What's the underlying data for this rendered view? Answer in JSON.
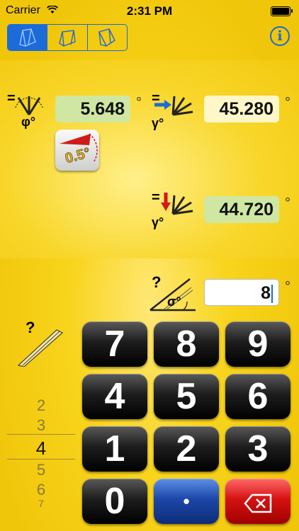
{
  "status_bar": {
    "carrier": "Carrier",
    "time": "2:31 PM"
  },
  "header": {
    "modes": [
      {
        "icon": "corner-view-1-icon",
        "selected": true
      },
      {
        "icon": "corner-view-2-icon",
        "selected": false
      },
      {
        "icon": "corner-view-3-icon",
        "selected": false
      }
    ],
    "info_label": "i"
  },
  "inputs": {
    "phi": {
      "symbol": "φ°",
      "prefix": "=",
      "value": "5.648",
      "unit": "°"
    },
    "gamma_top": {
      "symbol": "γ°",
      "prefix": "=",
      "value": "45.280",
      "unit": "°"
    },
    "gamma_bottom": {
      "symbol": "γ°",
      "prefix": "=",
      "value": "44.720",
      "unit": "°"
    },
    "sigma": {
      "symbol": "σ°",
      "prefix": "?",
      "value": "8",
      "unit": "°"
    }
  },
  "precision_button": {
    "label": "0.5°"
  },
  "moulding": {
    "prefix": "?"
  },
  "picker": {
    "values": [
      "2",
      "3",
      "4",
      "5",
      "6",
      "7"
    ],
    "selected": "4"
  },
  "keypad": {
    "keys": [
      "7",
      "8",
      "9",
      "4",
      "5",
      "6",
      "1",
      "2",
      "3",
      "0",
      "•",
      "⌫"
    ]
  },
  "colors": {
    "accent": "#1b6bd8",
    "background": "#f5cf14",
    "green_field": "#cfe7a2",
    "cream_field": "#fff7c8"
  }
}
